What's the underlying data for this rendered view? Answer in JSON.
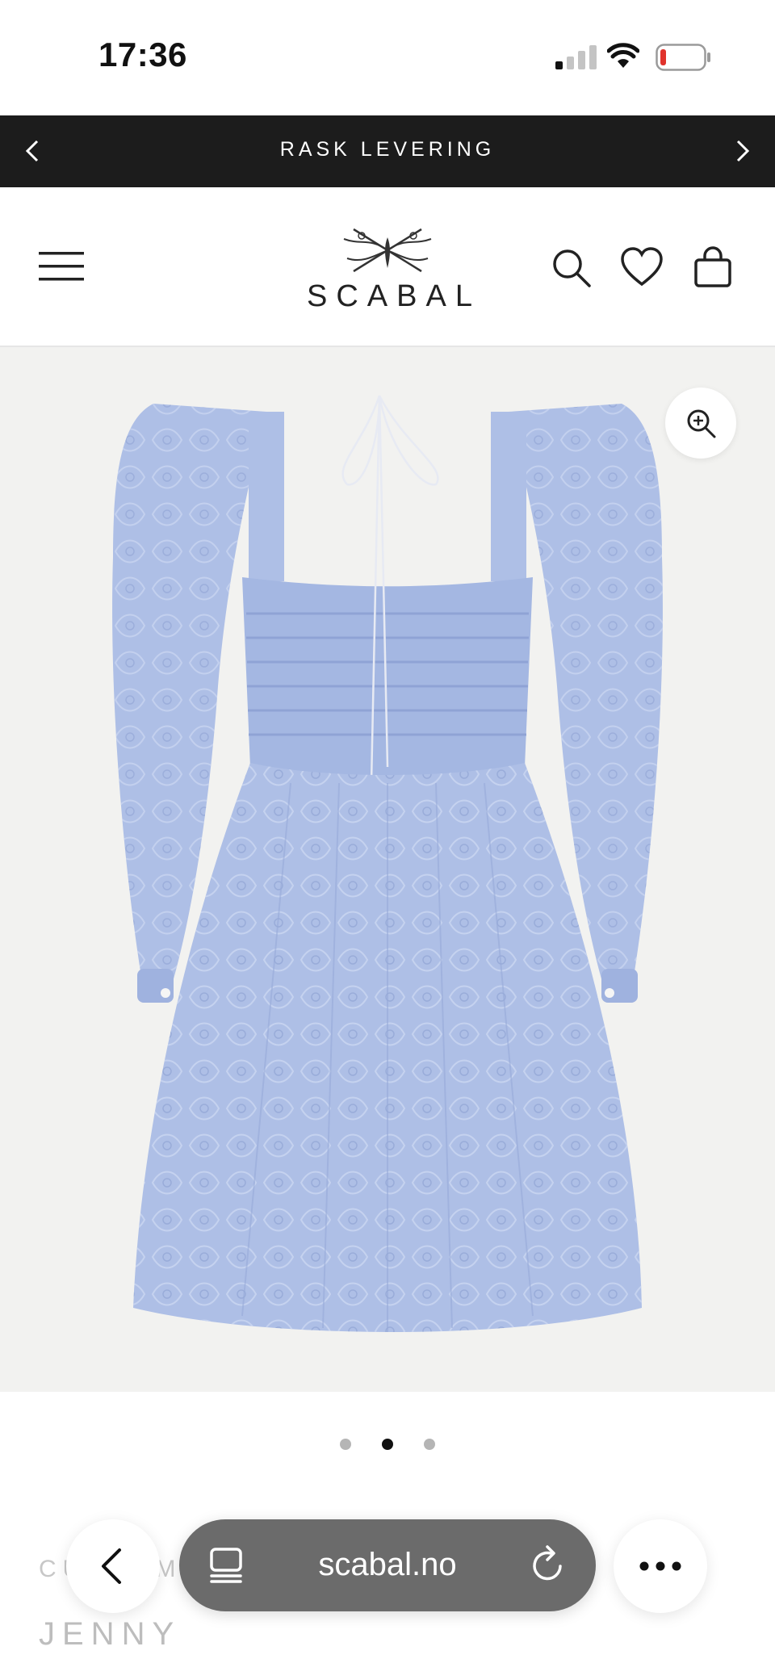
{
  "status_bar": {
    "time": "17:36"
  },
  "announcement": {
    "text": "RASK LEVERING"
  },
  "header": {
    "logo_text": "SCABAL"
  },
  "gallery": {
    "slide_count": 3,
    "active_slide": 2
  },
  "product": {
    "category": "CUSTOM M",
    "name": "JENNY"
  },
  "browser": {
    "url": "scabal.no"
  },
  "icons": [
    "signal-icon",
    "wifi-icon",
    "battery-icon",
    "chevron-left-icon",
    "chevron-right-icon",
    "menu-icon",
    "search-icon",
    "heart-icon",
    "bag-icon",
    "zoom-in-icon",
    "tabs-icon",
    "reload-icon",
    "more-icon"
  ],
  "colors": {
    "announce_bg": "#1c1c1c",
    "gallery_bg": "#f2f2f0",
    "dress": "#aebfe6",
    "battery_low": "#e0332c",
    "urlbar_bg": "#6b6b6b"
  }
}
